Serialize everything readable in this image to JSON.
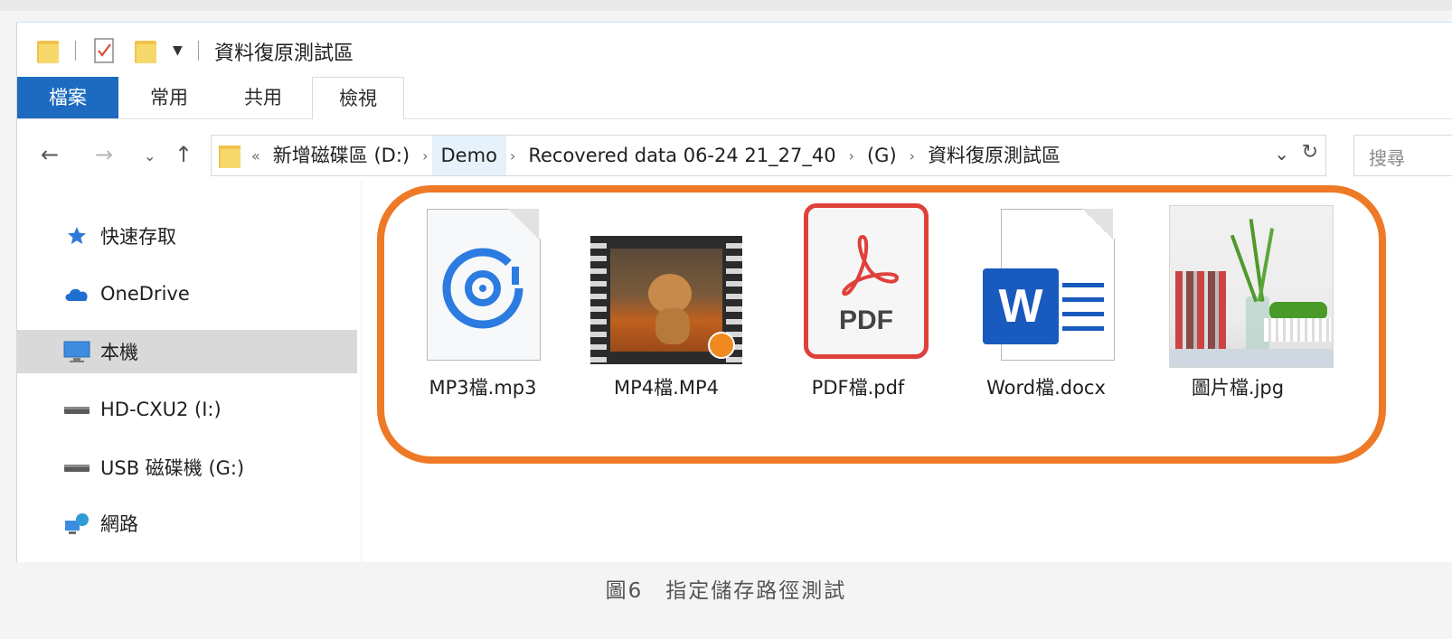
{
  "window": {
    "title": "資料復原測試區",
    "tabs": [
      "檔案",
      "常用",
      "共用",
      "檢視"
    ]
  },
  "address": {
    "overflow": "«",
    "crumbs": [
      "新增磁碟區 (D:)",
      "Demo",
      "Recovered data 06-24 21_27_40",
      "(G)",
      "資料復原測試區"
    ],
    "search_placeholder": "搜尋"
  },
  "sidebar": {
    "items": [
      {
        "label": "快速存取",
        "icon": "star-pin-icon"
      },
      {
        "label": "OneDrive",
        "icon": "cloud-icon"
      },
      {
        "label": "本機",
        "icon": "monitor-icon",
        "selected": true
      },
      {
        "label": "HD-CXU2 (I:)",
        "icon": "drive-icon"
      },
      {
        "label": "USB 磁碟機 (G:)",
        "icon": "drive-icon"
      },
      {
        "label": "網路",
        "icon": "network-icon"
      }
    ]
  },
  "files": [
    {
      "name": "MP3檔.mp3",
      "icon": "audio-file-icon"
    },
    {
      "name": "MP4檔.MP4",
      "icon": "video-thumbnail-icon"
    },
    {
      "name": "PDF檔.pdf",
      "icon": "pdf-file-icon",
      "icon_text": "PDF"
    },
    {
      "name": "Word檔.docx",
      "icon": "word-file-icon",
      "icon_text": "W"
    },
    {
      "name": "圖片檔.jpg",
      "icon": "image-thumbnail-icon"
    }
  ],
  "caption": "圖6　指定儲存路徑測試",
  "colors": {
    "accent": "#1c6bc0",
    "highlight": "#ee7a27",
    "pdf_red": "#e0403a",
    "word_blue": "#185abd",
    "mp3_blue": "#2b7be0"
  }
}
